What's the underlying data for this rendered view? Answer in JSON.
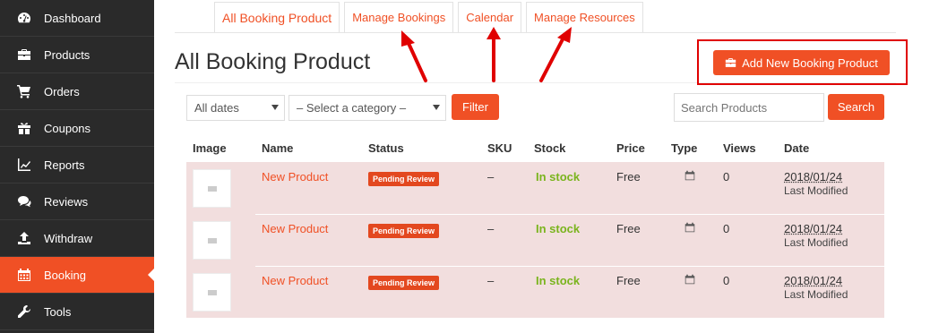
{
  "sidebar": {
    "items": [
      {
        "label": "Dashboard",
        "icon": "dashboard-icon"
      },
      {
        "label": "Products",
        "icon": "briefcase-icon"
      },
      {
        "label": "Orders",
        "icon": "cart-icon"
      },
      {
        "label": "Coupons",
        "icon": "gift-icon"
      },
      {
        "label": "Reports",
        "icon": "chart-icon"
      },
      {
        "label": "Reviews",
        "icon": "comments-icon"
      },
      {
        "label": "Withdraw",
        "icon": "upload-icon"
      },
      {
        "label": "Booking",
        "icon": "calendar-icon",
        "active": true
      },
      {
        "label": "Tools",
        "icon": "wrench-icon"
      }
    ]
  },
  "tabs": [
    {
      "label": "All Booking Product",
      "active": true
    },
    {
      "label": "Manage Bookings"
    },
    {
      "label": "Calendar"
    },
    {
      "label": "Manage Resources"
    }
  ],
  "page_title": "All Booking Product",
  "add_button": "Add New Booking Product",
  "filters": {
    "date_select": "All dates",
    "category_select": "– Select a category –",
    "filter_button": "Filter",
    "search_placeholder": "Search Products",
    "search_button": "Search"
  },
  "table": {
    "headers": [
      "Image",
      "Name",
      "Status",
      "SKU",
      "Stock",
      "Price",
      "Type",
      "Views",
      "Date"
    ],
    "rows": [
      {
        "name": "New Product",
        "status": "Pending Review",
        "sku": "–",
        "stock": "In stock",
        "price": "Free",
        "type_icon": "calendar-icon",
        "views": "0",
        "date": "2018/01/24",
        "date_note": "Last Modified"
      },
      {
        "name": "New Product",
        "status": "Pending Review",
        "sku": "–",
        "stock": "In stock",
        "price": "Free",
        "type_icon": "calendar-icon",
        "views": "0",
        "date": "2018/01/24",
        "date_note": "Last Modified"
      },
      {
        "name": "New Product",
        "status": "Pending Review",
        "sku": "–",
        "stock": "In stock",
        "price": "Free",
        "type_icon": "calendar-icon",
        "views": "0",
        "date": "2018/01/24",
        "date_note": "Last Modified"
      }
    ]
  },
  "colors": {
    "accent": "#f05025",
    "sidebar_bg": "#2a2a2a",
    "row_bg": "#f2dede",
    "stock_green": "#7ab41d",
    "annotation_red": "#e00000"
  }
}
